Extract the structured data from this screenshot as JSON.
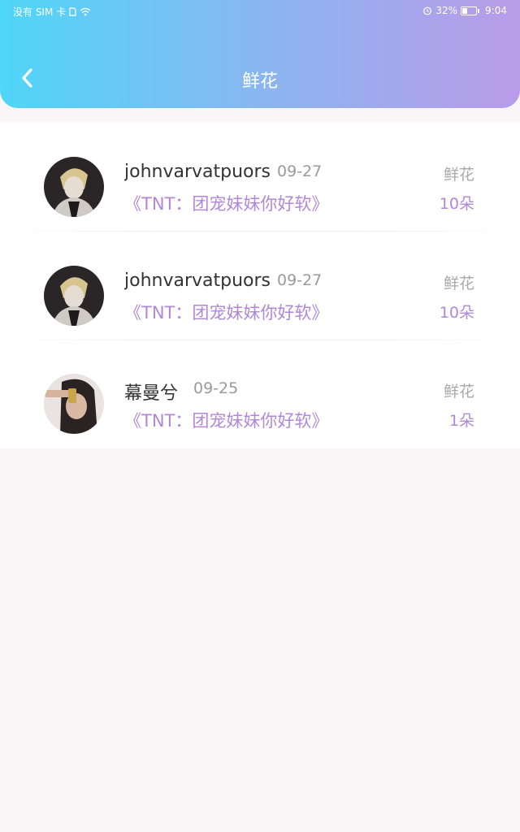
{
  "status_bar": {
    "carrier": "没有 SIM 卡",
    "battery": "32%",
    "time": "9:04"
  },
  "header": {
    "title": "鲜花",
    "back_icon": "chevron-left-icon"
  },
  "records": [
    {
      "name": "johnvarvatpuors..",
      "date": "09-27",
      "book": "《TNT：团宠妹妹你好软》",
      "gift_type": "鲜花",
      "count": "10朵"
    },
    {
      "name": "johnvarvatpuors..",
      "date": "09-27",
      "book": "《TNT：团宠妹妹你好软》",
      "gift_type": "鲜花",
      "count": "10朵"
    },
    {
      "name": "幕曼兮",
      "date": "09-25",
      "book": "《TNT：团宠妹妹你好软》",
      "gift_type": "鲜花",
      "count": "1朵"
    }
  ],
  "colors": {
    "header_gradient_start": "#4fd6f8",
    "header_gradient_end": "#b99be9",
    "accent_purple": "#b387d7"
  }
}
